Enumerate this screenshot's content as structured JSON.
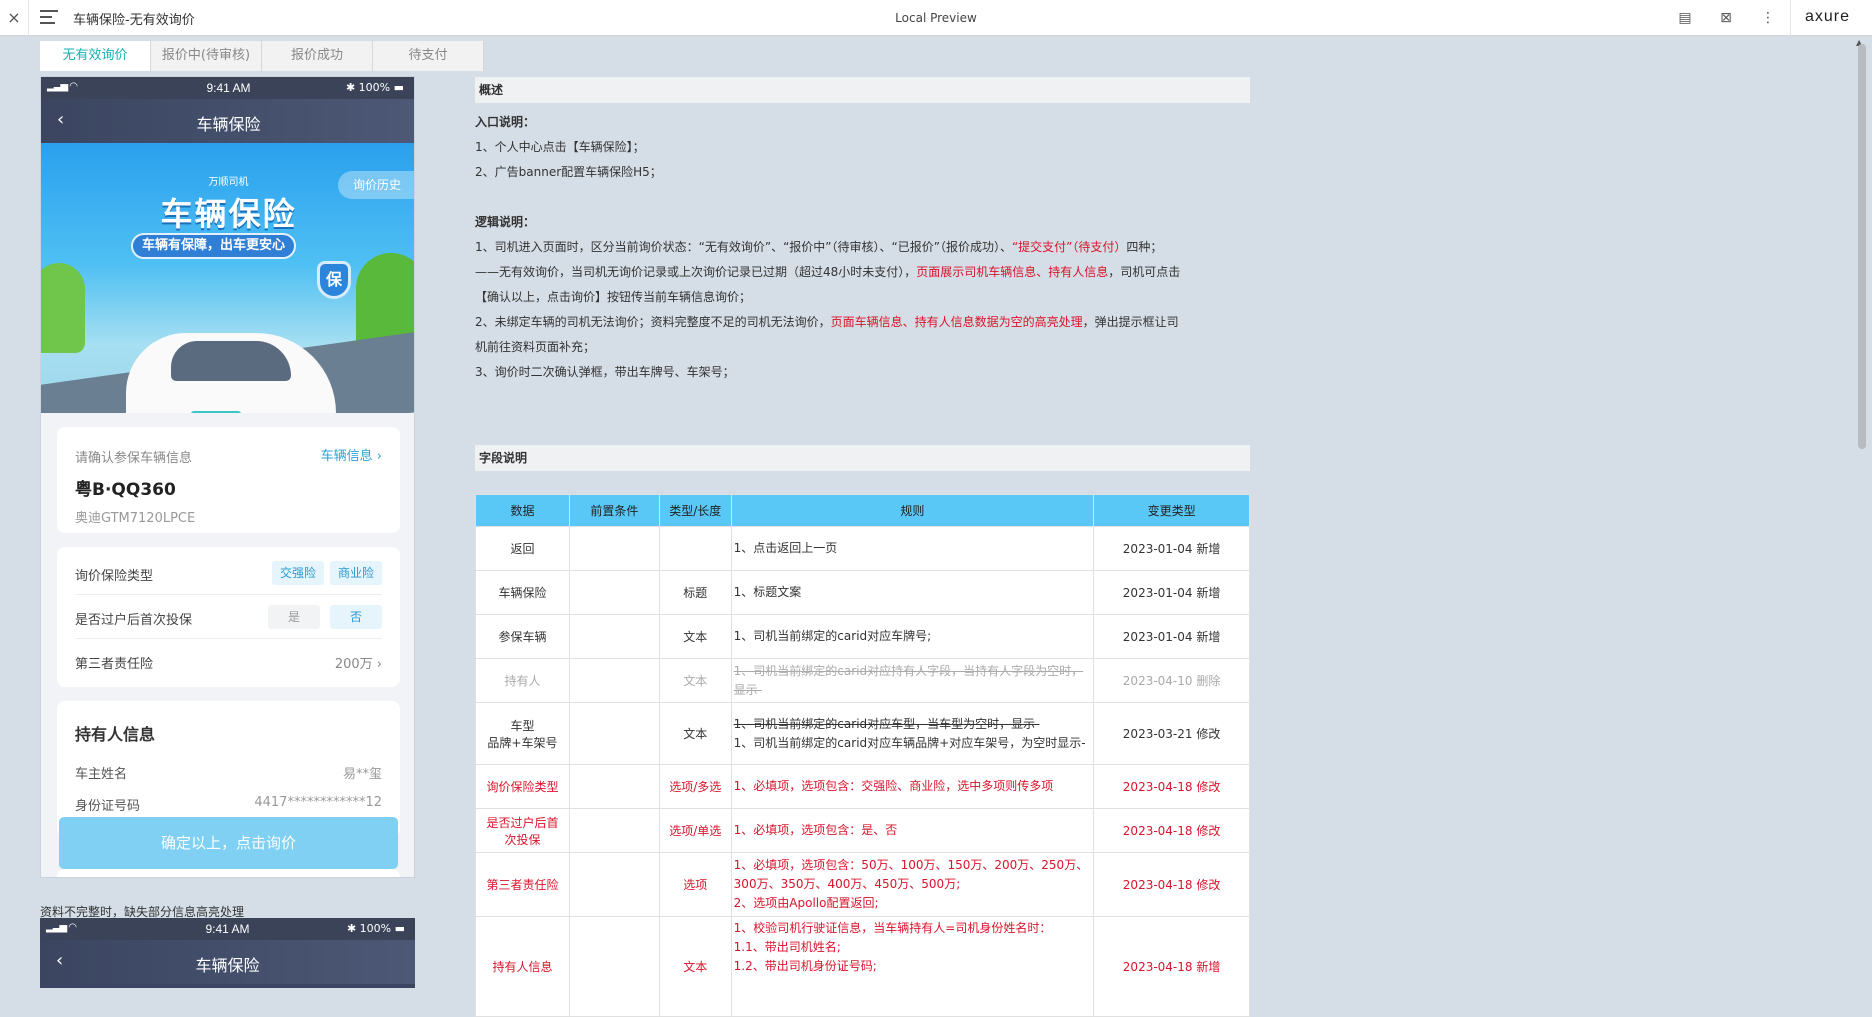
{
  "topbar": {
    "close": "×",
    "title": "车辆保险-无有效询价",
    "center": "Local Preview",
    "logo": "axure"
  },
  "tabs": [
    {
      "label": "无有效询价",
      "active": true
    },
    {
      "label": "报价中(待审核)",
      "active": false
    },
    {
      "label": "报价成功",
      "active": false
    },
    {
      "label": "待支付",
      "active": false
    }
  ],
  "phone": {
    "time": "9:41 AM",
    "battery": "100%",
    "nav_title": "车辆保险",
    "banner_brand": "万顺司机",
    "banner_title": "车辆保险",
    "banner_slogan": "车辆有保障，出车更安心",
    "history_btn": "询价历史",
    "shield": "保",
    "vehicle": {
      "label": "请确认参保车辆信息",
      "link": "车辆信息",
      "plate": "粤B·QQ360",
      "model": "奥迪GTM7120LPCE"
    },
    "options": {
      "insurance_type_label": "询价保险类型",
      "insurance_types": [
        "交强险",
        "商业险"
      ],
      "first_insure_label": "是否过户后首次投保",
      "yes": "是",
      "no": "否",
      "third_party_label": "第三者责任险",
      "third_party_value": "200万"
    },
    "holder": {
      "title": "持有人信息",
      "name_label": "车主姓名",
      "name_value": "易**玺",
      "id_label": "身份证号码",
      "id_value": "4417************12"
    },
    "cta": "确定以上，点击询价"
  },
  "caption": "资料不完整时，缺失部分信息高亮处理",
  "doc": {
    "overview_header": "概述",
    "entry_title": "入口说明：",
    "entry_1": "1、个人中心点击【车辆保险】；",
    "entry_2": "2、广告banner配置车辆保险H5；",
    "logic_title": "逻辑说明：",
    "logic_1a": "1、司机进入页面时，区分当前询价状态：“无有效询价”、“报价中”（待审核）、“已报价”（报价成功）、",
    "logic_1b": "“提交支付”（待支付）",
    "logic_1c": "四种；",
    "logic_2a": "——无有效询价，当司机无询价记录或上次询价记录已过期（超过48小时未支付），",
    "logic_2b": "页面展示司机车辆信息、持有人信息",
    "logic_2c": "，司机可点击",
    "logic_3": "【确认以上，点击询价】按钮传当前车辆信息询价；",
    "logic_4a": "2、未绑定车辆的司机无法询价；资料完整度不足的司机无法询价，",
    "logic_4b": "页面车辆信息、持有人信息数据为空的高亮处理",
    "logic_4c": "，弹出提示框让司",
    "logic_5": "机前往资料页面补充；",
    "logic_6": "3、询价时二次确认弹框，带出车牌号、车架号；",
    "fields_header": "字段说明",
    "table_headers": [
      "数据",
      "前置条件",
      "类型/长度",
      "规则",
      "变更类型"
    ],
    "rows": [
      {
        "data": "返回",
        "pre": "",
        "type": "",
        "rule": "1、点击返回上一页",
        "change": "2023-01-04 新增"
      },
      {
        "data": "车辆保险",
        "pre": "",
        "type": "标题",
        "rule": "1、标题文案",
        "change": "2023-01-04 新增"
      },
      {
        "data": "参保车辆",
        "pre": "",
        "type": "文本",
        "rule": "1、司机当前绑定的carid对应车牌号;",
        "change": "2023-01-04 新增"
      },
      {
        "data": "持有人",
        "pre": "",
        "type": "文本",
        "rule": "1、司机当前绑定的carid对应持有人字段，当持有人字段为空时，显示-",
        "change": "2023-04-10 删除"
      },
      {
        "data": "车型\n品牌+车架号",
        "pre": "",
        "type": "文本",
        "rule_strike": "1、司机当前绑定的carid对应车型，当车型为空时，显示-",
        "rule": "1、司机当前绑定的carid对应车辆品牌+对应车架号，为空时显示-",
        "change": "2023-03-21 修改"
      },
      {
        "data": "询价保险类型",
        "pre": "",
        "type": "选项/多选",
        "rule": "1、必填项，选项包含：交强险、商业险，选中多项则传多项",
        "change": "2023-04-18 修改"
      },
      {
        "data": "是否过户后首\n次投保",
        "pre": "",
        "type": "选项/单选",
        "rule": "1、必填项，选项包含：是、否",
        "change": "2023-04-18 修改"
      },
      {
        "data": "第三者责任险",
        "pre": "",
        "type": "选项",
        "rule": "1、必填项，选项包含：50万、100万、150万、200万、250万、300万、350万、400万、450万、500万;\n2、选项由Apollo配置返回;",
        "change": "2023-04-18 修改"
      },
      {
        "data": "持有人信息",
        "pre": "",
        "type": "文本",
        "rule": "1、校验司机行驶证信息，当车辆持有人=司机身份姓名时：\n1.1、带出司机姓名;\n1.2、带出司机身份证号码;",
        "change": "2023-04-18 新增"
      }
    ]
  },
  "colors": {
    "accent": "#1ab0b0",
    "red": "#d9142b",
    "table_header": "#5ac8f7",
    "cta": "#7fd0f2"
  }
}
